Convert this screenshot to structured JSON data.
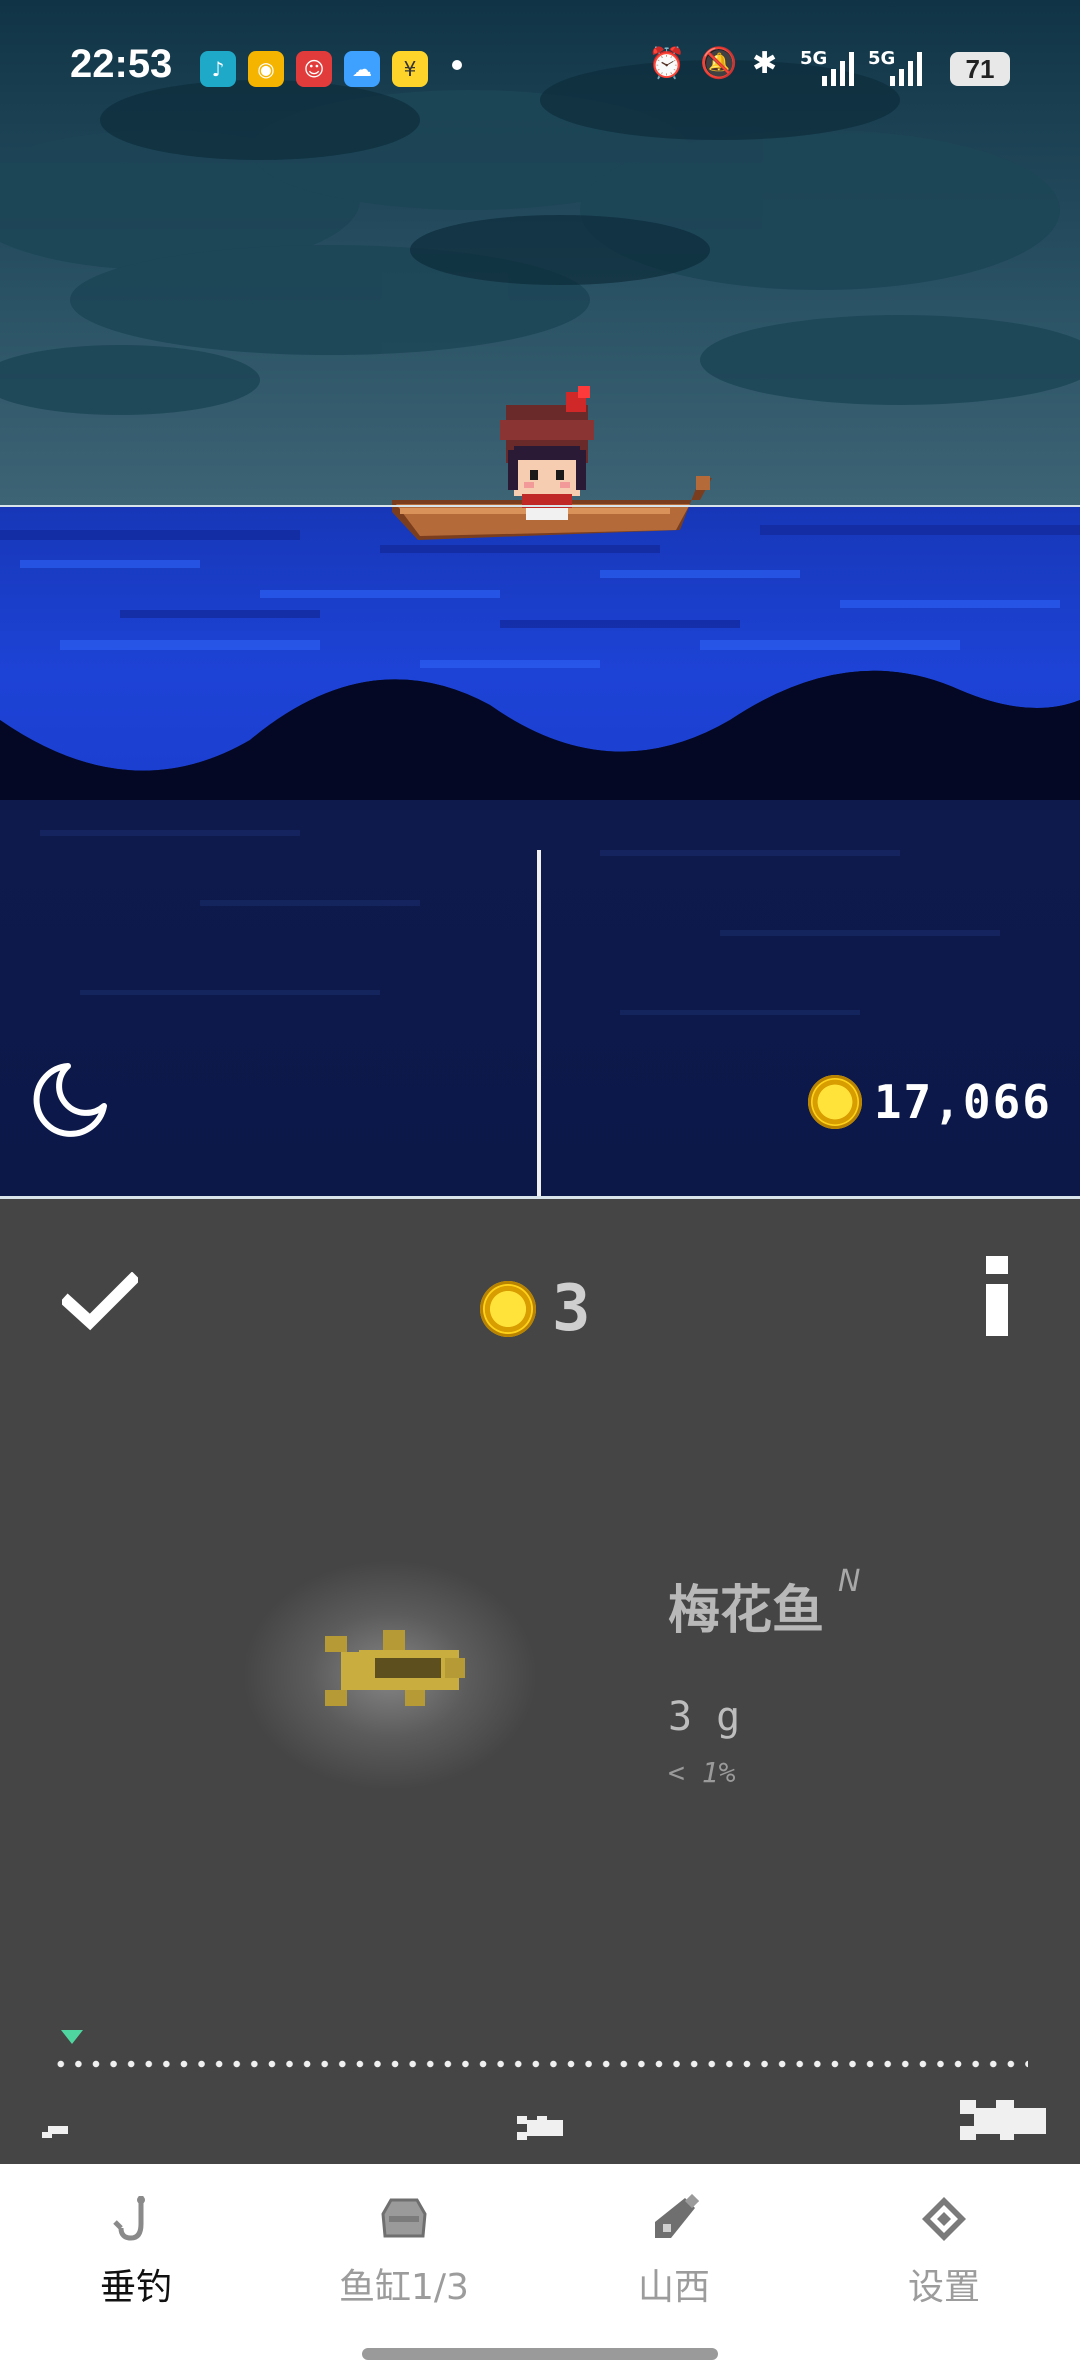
{
  "status_bar": {
    "time": "22:53",
    "app_icons": [
      "music-app-icon",
      "weibo-icon",
      "game-app-icon",
      "weather-icon",
      "bank-app-icon"
    ],
    "system_icons": [
      "alarm-icon",
      "mute-icon",
      "bluetooth-icon",
      "signal-5g-icon",
      "signal-5g-icon"
    ],
    "signal_1": "5G",
    "signal_2": "5G",
    "battery": "71"
  },
  "game": {
    "time_of_day_icon": "moon-icon",
    "total_coins": "17,066",
    "colors": {
      "sky": "#2c5566",
      "sea": "#1e3fd4",
      "deep_sea": "#0a1240",
      "panel": "#454545"
    }
  },
  "catch_panel": {
    "reward_coins": "3",
    "fish": {
      "name": "梅花鱼",
      "rank": "N",
      "weight": "3 g",
      "percentile": "< 1%"
    },
    "size_progress": 0.01
  },
  "tabs": [
    {
      "label": "垂钓",
      "icon": "hook-icon",
      "active": true
    },
    {
      "label": "鱼缸1/3",
      "icon": "fish-tank-icon",
      "active": false
    },
    {
      "label": "山西",
      "icon": "location-icon",
      "active": false
    },
    {
      "label": "设置",
      "icon": "settings-icon",
      "active": false
    }
  ]
}
